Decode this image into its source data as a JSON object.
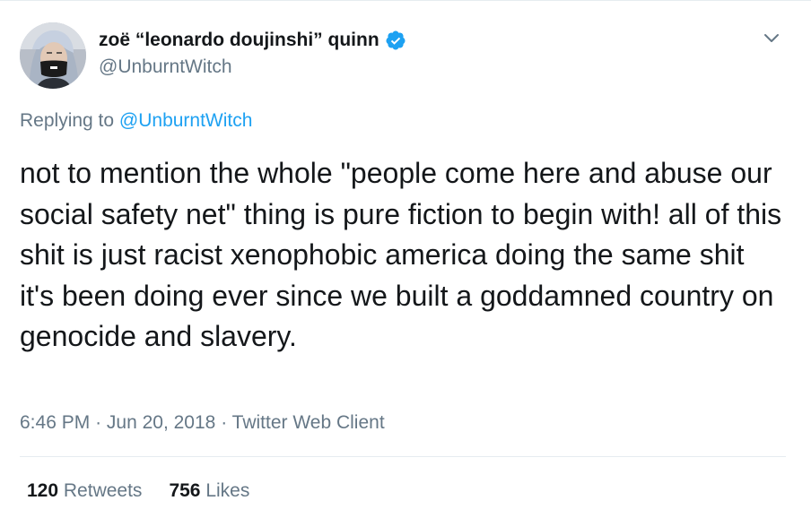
{
  "author": {
    "display_name": "zoë “leonardo doujinshi” quinn",
    "handle": "@UnburntWitch",
    "verified": true,
    "avatar_icon": "profile-photo"
  },
  "reply": {
    "prefix": "Replying to",
    "mention": "@UnburntWitch"
  },
  "tweet": {
    "text": "not to mention the whole \"people come here and abuse our social safety net\" thing is pure fiction to begin with! all of this shit is just racist xenophobic america doing the same shit it's been doing ever since we built a goddamned country on genocide and slavery."
  },
  "meta": {
    "time": "6:46 PM",
    "date": "Jun 20, 2018",
    "client": "Twitter Web Client",
    "separator": "·"
  },
  "stats": {
    "retweets_count": "120",
    "retweets_label": "Retweets",
    "likes_count": "756",
    "likes_label": "Likes"
  },
  "colors": {
    "text": "#14171a",
    "secondary": "#657786",
    "accent": "#1da1f2",
    "divider": "#e6ecf0"
  }
}
